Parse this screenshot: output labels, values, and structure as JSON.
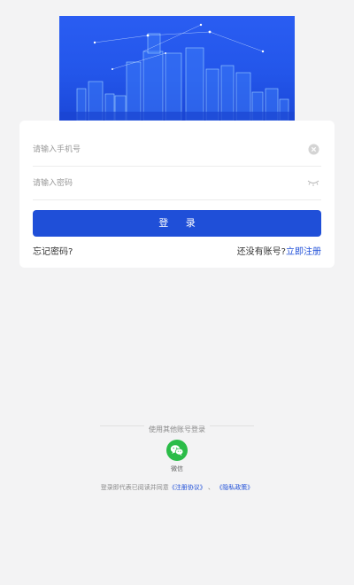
{
  "login_form": {
    "phone_placeholder": "请输入手机号",
    "password_placeholder": "请输入密码",
    "login_button": "登 录",
    "forgot_password": "忘记密码?",
    "no_account_text": "还没有账号?",
    "register_link": "立即注册"
  },
  "other_login": {
    "title": "使用其他账号登录",
    "wechat_label": "微信"
  },
  "agreement": {
    "prefix": "登录即代表已阅读并同意",
    "terms": "《注册协议》",
    "separator": " 、 ",
    "privacy": "《隐私政策》"
  },
  "colors": {
    "primary": "#1f4fd8",
    "banner": "#2356ea",
    "wechat": "#2bbc48",
    "background": "#f3f3f4"
  },
  "icons": {
    "clear": "clear-icon",
    "eye": "eye-closed-icon",
    "wechat": "wechat-icon",
    "banner": "city-skyline"
  }
}
